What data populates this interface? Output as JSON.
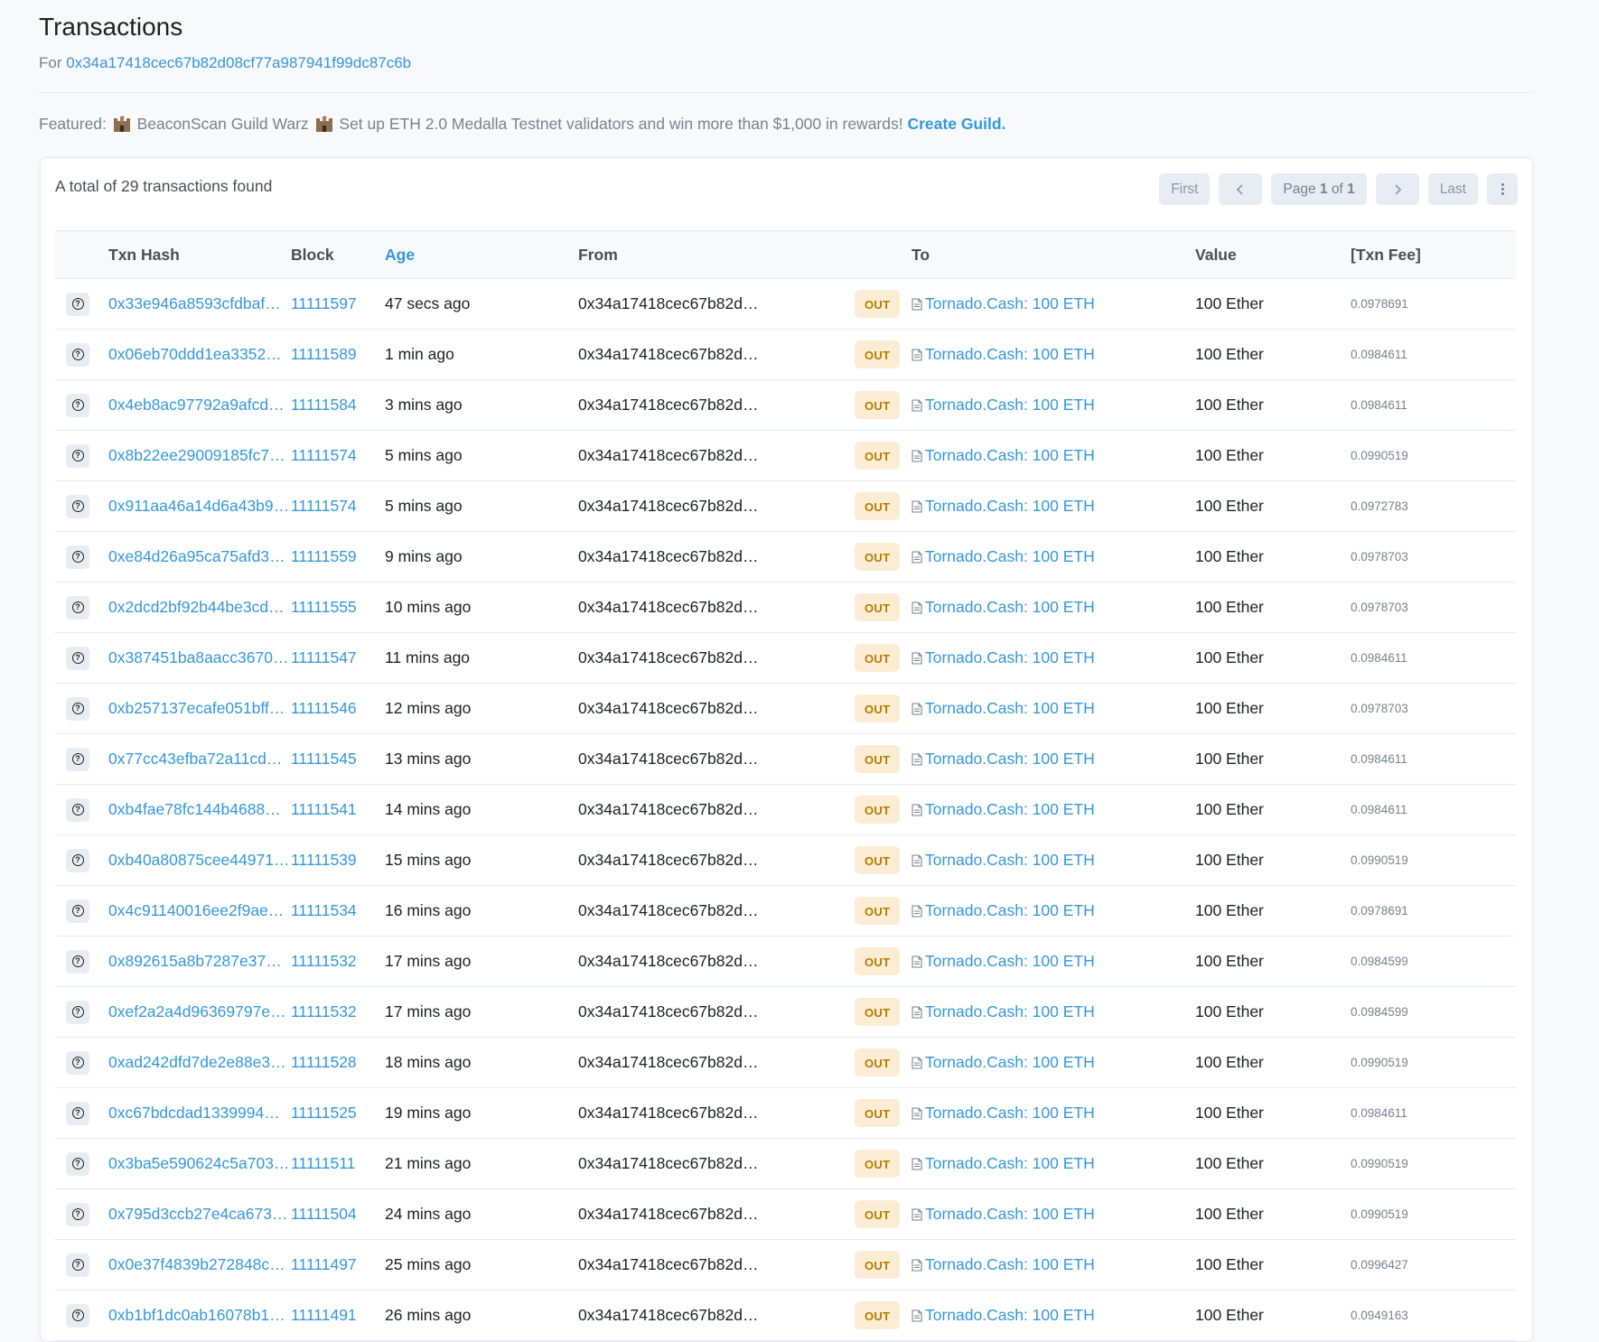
{
  "header": {
    "title": "Transactions",
    "for_label": "For",
    "address": "0x34a17418cec67b82d08cf77a987941f99dc87c6b"
  },
  "featured": {
    "prefix": "Featured:",
    "name": "BeaconScan Guild Warz",
    "text": "Set up ETH 2.0 Medalla Testnet validators and win more than $1,000 in rewards!",
    "cta": "Create Guild."
  },
  "summary": {
    "total_text": "A total of 29 transactions found"
  },
  "pager": {
    "first": "First",
    "page_prefix": "Page",
    "page_current": "1",
    "page_of": "of",
    "page_total": "1",
    "last": "Last"
  },
  "columns": {
    "hash": "Txn Hash",
    "block": "Block",
    "age": "Age",
    "from": "From",
    "to": "To",
    "value": "Value",
    "fee": "[Txn Fee]"
  },
  "accent_color": "#3498db",
  "rows": [
    {
      "hash": "0x33e946a8593cfdbaf…",
      "block": "11111597",
      "age": "47 secs ago",
      "from": "0x34a17418cec67b82d…",
      "dir": "OUT",
      "to": "Tornado.Cash: 100 ETH",
      "value": "100 Ether",
      "fee": "0.0978691"
    },
    {
      "hash": "0x06eb70ddd1ea3352…",
      "block": "11111589",
      "age": "1 min ago",
      "from": "0x34a17418cec67b82d…",
      "dir": "OUT",
      "to": "Tornado.Cash: 100 ETH",
      "value": "100 Ether",
      "fee": "0.0984611"
    },
    {
      "hash": "0x4eb8ac97792a9afcd…",
      "block": "11111584",
      "age": "3 mins ago",
      "from": "0x34a17418cec67b82d…",
      "dir": "OUT",
      "to": "Tornado.Cash: 100 ETH",
      "value": "100 Ether",
      "fee": "0.0984611"
    },
    {
      "hash": "0x8b22ee29009185fc7…",
      "block": "11111574",
      "age": "5 mins ago",
      "from": "0x34a17418cec67b82d…",
      "dir": "OUT",
      "to": "Tornado.Cash: 100 ETH",
      "value": "100 Ether",
      "fee": "0.0990519"
    },
    {
      "hash": "0x911aa46a14d6a43b9…",
      "block": "11111574",
      "age": "5 mins ago",
      "from": "0x34a17418cec67b82d…",
      "dir": "OUT",
      "to": "Tornado.Cash: 100 ETH",
      "value": "100 Ether",
      "fee": "0.0972783"
    },
    {
      "hash": "0xe84d26a95ca75afd3…",
      "block": "11111559",
      "age": "9 mins ago",
      "from": "0x34a17418cec67b82d…",
      "dir": "OUT",
      "to": "Tornado.Cash: 100 ETH",
      "value": "100 Ether",
      "fee": "0.0978703"
    },
    {
      "hash": "0x2dcd2bf92b44be3cd…",
      "block": "11111555",
      "age": "10 mins ago",
      "from": "0x34a17418cec67b82d…",
      "dir": "OUT",
      "to": "Tornado.Cash: 100 ETH",
      "value": "100 Ether",
      "fee": "0.0978703"
    },
    {
      "hash": "0x387451ba8aacc3670…",
      "block": "11111547",
      "age": "11 mins ago",
      "from": "0x34a17418cec67b82d…",
      "dir": "OUT",
      "to": "Tornado.Cash: 100 ETH",
      "value": "100 Ether",
      "fee": "0.0984611"
    },
    {
      "hash": "0xb257137ecafe051bff…",
      "block": "11111546",
      "age": "12 mins ago",
      "from": "0x34a17418cec67b82d…",
      "dir": "OUT",
      "to": "Tornado.Cash: 100 ETH",
      "value": "100 Ether",
      "fee": "0.0978703"
    },
    {
      "hash": "0x77cc43efba72a11cd…",
      "block": "11111545",
      "age": "13 mins ago",
      "from": "0x34a17418cec67b82d…",
      "dir": "OUT",
      "to": "Tornado.Cash: 100 ETH",
      "value": "100 Ether",
      "fee": "0.0984611"
    },
    {
      "hash": "0xb4fae78fc144b4688…",
      "block": "11111541",
      "age": "14 mins ago",
      "from": "0x34a17418cec67b82d…",
      "dir": "OUT",
      "to": "Tornado.Cash: 100 ETH",
      "value": "100 Ether",
      "fee": "0.0984611"
    },
    {
      "hash": "0xb40a80875cee44971…",
      "block": "11111539",
      "age": "15 mins ago",
      "from": "0x34a17418cec67b82d…",
      "dir": "OUT",
      "to": "Tornado.Cash: 100 ETH",
      "value": "100 Ether",
      "fee": "0.0990519"
    },
    {
      "hash": "0x4c91140016ee2f9ae…",
      "block": "11111534",
      "age": "16 mins ago",
      "from": "0x34a17418cec67b82d…",
      "dir": "OUT",
      "to": "Tornado.Cash: 100 ETH",
      "value": "100 Ether",
      "fee": "0.0978691"
    },
    {
      "hash": "0x892615a8b7287e37…",
      "block": "11111532",
      "age": "17 mins ago",
      "from": "0x34a17418cec67b82d…",
      "dir": "OUT",
      "to": "Tornado.Cash: 100 ETH",
      "value": "100 Ether",
      "fee": "0.0984599"
    },
    {
      "hash": "0xef2a2a4d96369797e…",
      "block": "11111532",
      "age": "17 mins ago",
      "from": "0x34a17418cec67b82d…",
      "dir": "OUT",
      "to": "Tornado.Cash: 100 ETH",
      "value": "100 Ether",
      "fee": "0.0984599"
    },
    {
      "hash": "0xad242dfd7de2e88e3…",
      "block": "11111528",
      "age": "18 mins ago",
      "from": "0x34a17418cec67b82d…",
      "dir": "OUT",
      "to": "Tornado.Cash: 100 ETH",
      "value": "100 Ether",
      "fee": "0.0990519"
    },
    {
      "hash": "0xc67bdcdad1339994…",
      "block": "11111525",
      "age": "19 mins ago",
      "from": "0x34a17418cec67b82d…",
      "dir": "OUT",
      "to": "Tornado.Cash: 100 ETH",
      "value": "100 Ether",
      "fee": "0.0984611"
    },
    {
      "hash": "0x3ba5e590624c5a703…",
      "block": "11111511",
      "age": "21 mins ago",
      "from": "0x34a17418cec67b82d…",
      "dir": "OUT",
      "to": "Tornado.Cash: 100 ETH",
      "value": "100 Ether",
      "fee": "0.0990519"
    },
    {
      "hash": "0x795d3ccb27e4ca673…",
      "block": "11111504",
      "age": "24 mins ago",
      "from": "0x34a17418cec67b82d…",
      "dir": "OUT",
      "to": "Tornado.Cash: 100 ETH",
      "value": "100 Ether",
      "fee": "0.0990519"
    },
    {
      "hash": "0x0e37f4839b272848c…",
      "block": "11111497",
      "age": "25 mins ago",
      "from": "0x34a17418cec67b82d…",
      "dir": "OUT",
      "to": "Tornado.Cash: 100 ETH",
      "value": "100 Ether",
      "fee": "0.0996427"
    },
    {
      "hash": "0xb1bf1dc0ab16078b1…",
      "block": "11111491",
      "age": "26 mins ago",
      "from": "0x34a17418cec67b82d…",
      "dir": "OUT",
      "to": "Tornado.Cash: 100 ETH",
      "value": "100 Ether",
      "fee": "0.0949163"
    }
  ]
}
